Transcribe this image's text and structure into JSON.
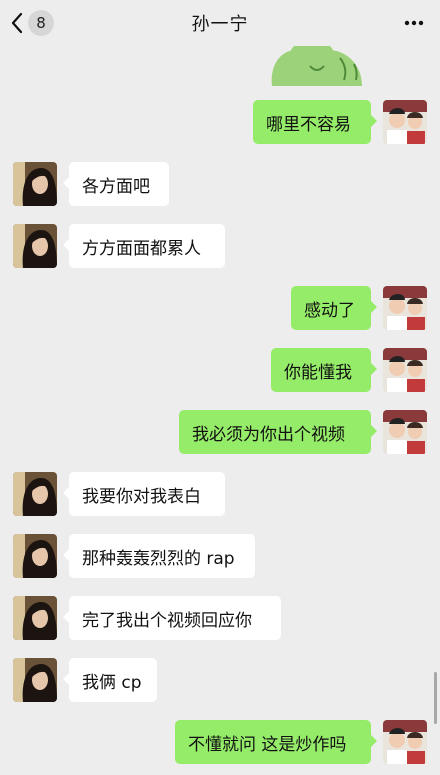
{
  "header": {
    "title": "孙一宁",
    "unread_count": "8",
    "back_icon": "chevron-left-icon",
    "more_icon": "more-dots-icon"
  },
  "colors": {
    "background": "#ededed",
    "bubble_sent": "#95ec69",
    "bubble_received": "#ffffff"
  },
  "messages": [
    {
      "side": "right",
      "text": "哪里不容易"
    },
    {
      "side": "left",
      "text": "各方面吧"
    },
    {
      "side": "left",
      "text": "方方面面都累人"
    },
    {
      "side": "right",
      "text": "感动了"
    },
    {
      "side": "right",
      "text": "你能懂我"
    },
    {
      "side": "right",
      "text": "我必须为你出个视频"
    },
    {
      "side": "left",
      "text": "我要你对我表白"
    },
    {
      "side": "left",
      "text": "那种轰轰烈烈的 rap"
    },
    {
      "side": "left",
      "text": "完了我出个视频回应你"
    },
    {
      "side": "left",
      "text": "我俩 cp"
    },
    {
      "side": "right",
      "text": "不懂就问 这是炒作吗"
    }
  ]
}
